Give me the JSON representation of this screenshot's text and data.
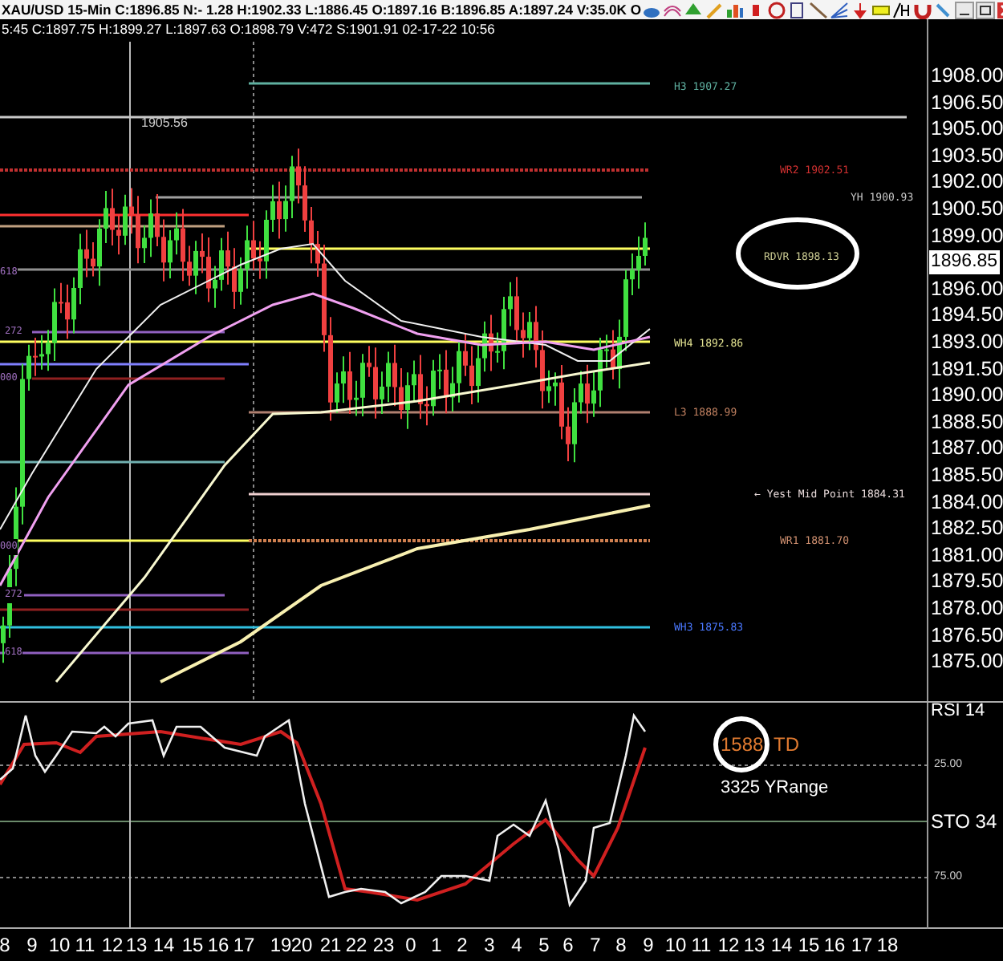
{
  "header": {
    "quote": "XAU/USD  15-Min  C:1896.85  N:- 1.28  H:1902.33  L:1886.45  O:1897.16  B:1896.85  A:1897.24  V:35.0K  O"
  },
  "price_chart": {
    "bar_info": "5:45  C:1897.75  H:1899.27  L:1897.63  O:1898.79  V:472  S:1901.91  02-17-22  10:56",
    "high_label": "1905.56",
    "level_labels": [
      {
        "text": "H3 1907.27",
        "color": "#5fb0a0"
      },
      {
        "text": "WR2 1902.51",
        "color": "#d03030"
      },
      {
        "text": "YH 1900.93",
        "color": "#c8c8c8"
      },
      {
        "text": "RDVR 1898.13",
        "color": "#c8c890"
      },
      {
        "text": "WH4 1892.86",
        "color": "#e0e090"
      },
      {
        "text": "L3 1888.99",
        "color": "#c08060"
      },
      {
        "text": "← Yest Mid Point 1884.31",
        "color": "#e8dada"
      },
      {
        "text": "WR1 1881.70",
        "color": "#d09070"
      },
      {
        "text": "WH3 1875.83",
        "color": "#4a78ff"
      }
    ],
    "fib_labels": [
      "618",
      "272",
      "000",
      "000",
      "272",
      "618"
    ],
    "price_axis": [
      "1908.00",
      "1906.50",
      "1905.00",
      "1903.50",
      "1902.00",
      "1900.50",
      "1899.00",
      "1896.00",
      "1894.50",
      "1893.00",
      "1891.50",
      "1890.00",
      "1888.50",
      "1887.00",
      "1885.50",
      "1884.00",
      "1882.50",
      "1881.00",
      "1879.50",
      "1878.00",
      "1876.50",
      "1875.00"
    ],
    "current_price": "1896.85"
  },
  "indicator": {
    "rsi_label": "RSI 14",
    "sto_label": "STO 34",
    "levels": [
      "25.00",
      "75.00"
    ],
    "td_value": "1588",
    "td_label": "TD",
    "yrange": "3325 YRange"
  },
  "time_axis": [
    "8",
    "9",
    "10",
    "11",
    "12",
    "13",
    "14",
    "15",
    "16",
    "17",
    "19",
    "20",
    "21",
    "22",
    "23",
    "0",
    "1",
    "2",
    "3",
    "4",
    "5",
    "6",
    "7",
    "8",
    "9",
    "10",
    "11",
    "12",
    "13",
    "14",
    "15",
    "16",
    "17",
    "18"
  ]
}
